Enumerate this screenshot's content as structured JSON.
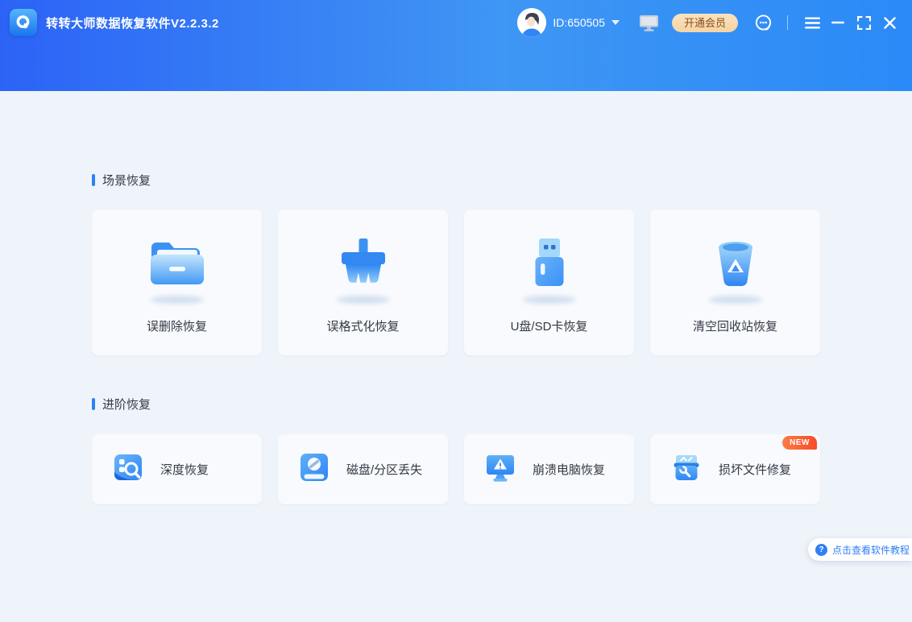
{
  "window": {
    "title": "转转大师数据恢复软件V2.2.3.2",
    "logo_icon": "recovery-q-arrow-icon",
    "controls": [
      "menu-icon",
      "minimize-icon",
      "maximize-icon",
      "close-icon"
    ]
  },
  "header": {
    "user_id": "ID:650505",
    "avatar_icon": "user-avatar",
    "monitor_icon": "device-monitor-icon",
    "vip_button_label": "开通会员",
    "support_icon": "customer-service-icon"
  },
  "sections": {
    "scene": {
      "title": "场景恢复",
      "cards": [
        {
          "label": "误删除恢复",
          "icon": "folder-icon"
        },
        {
          "label": "误格式化恢复",
          "icon": "format-brush-icon"
        },
        {
          "label": "U盘/SD卡恢复",
          "icon": "usb-drive-icon"
        },
        {
          "label": "清空回收站恢复",
          "icon": "recycle-bin-icon"
        }
      ]
    },
    "advanced": {
      "title": "进阶恢复",
      "cards": [
        {
          "label": "深度恢复",
          "icon": "deep-scan-icon"
        },
        {
          "label": "磁盘/分区丢失",
          "icon": "disk-partition-icon"
        },
        {
          "label": "崩溃电脑恢复",
          "icon": "crashed-pc-icon"
        },
        {
          "label": "损坏文件修复",
          "icon": "file-repair-icon",
          "badge": "NEW"
        }
      ]
    }
  },
  "tutorial": {
    "label": "点击查看软件教程",
    "icon_glyph": "?"
  },
  "colors": {
    "header_gradient": [
      "#2c63f6",
      "#3f96f4",
      "#2a8af7"
    ],
    "accent_blue": "#2e80f6",
    "page_bg": "#eff4fa",
    "card_bg": "#f8fafd",
    "vip_bg": "#f8d9ad",
    "vip_text": "#8a4f1d",
    "badge_gradient": [
      "#fd7b44",
      "#f94b2b"
    ],
    "label_text": "#333a45"
  }
}
